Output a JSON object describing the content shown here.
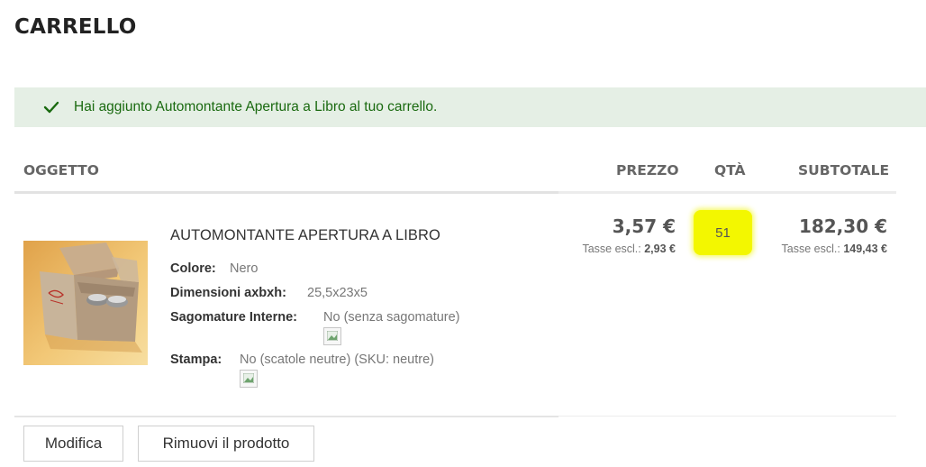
{
  "page": {
    "title": "CARRELLO"
  },
  "notice": {
    "message": "Hai aggiunto Automontante Apertura a Libro al tuo carrello.",
    "icon": "check-icon",
    "color": "#1a6a10"
  },
  "table": {
    "headers": {
      "item": "OGGETTO",
      "price": "PREZZO",
      "qty": "QTÀ",
      "subtotal": "SUBTOTALE"
    }
  },
  "item": {
    "name": "AUTOMONTANTE APERTURA A LIBRO",
    "image": "product-box-image",
    "options": [
      {
        "label": "Colore:",
        "value": "Nero"
      },
      {
        "label": "Dimensioni axbxh:",
        "value": "25,5x23x5"
      },
      {
        "label": "Sagomature Interne:",
        "value": "No (senza sagomature)"
      },
      {
        "label": "Stampa:",
        "value": "No (scatole neutre) (SKU: neutre)"
      }
    ],
    "price": "3,57 €",
    "price_tax_label": "Tasse escl.:",
    "price_tax_value": "2,93 €",
    "qty": "51",
    "subtotal": "182,30 €",
    "subtotal_tax_label": "Tasse escl.:",
    "subtotal_tax_value": "149,43 €"
  },
  "actions": {
    "edit": "Modifica",
    "remove": "Rimuovi il prodotto"
  },
  "colors": {
    "highlight": "#f3f700",
    "notice_bg": "#e5efe5"
  }
}
